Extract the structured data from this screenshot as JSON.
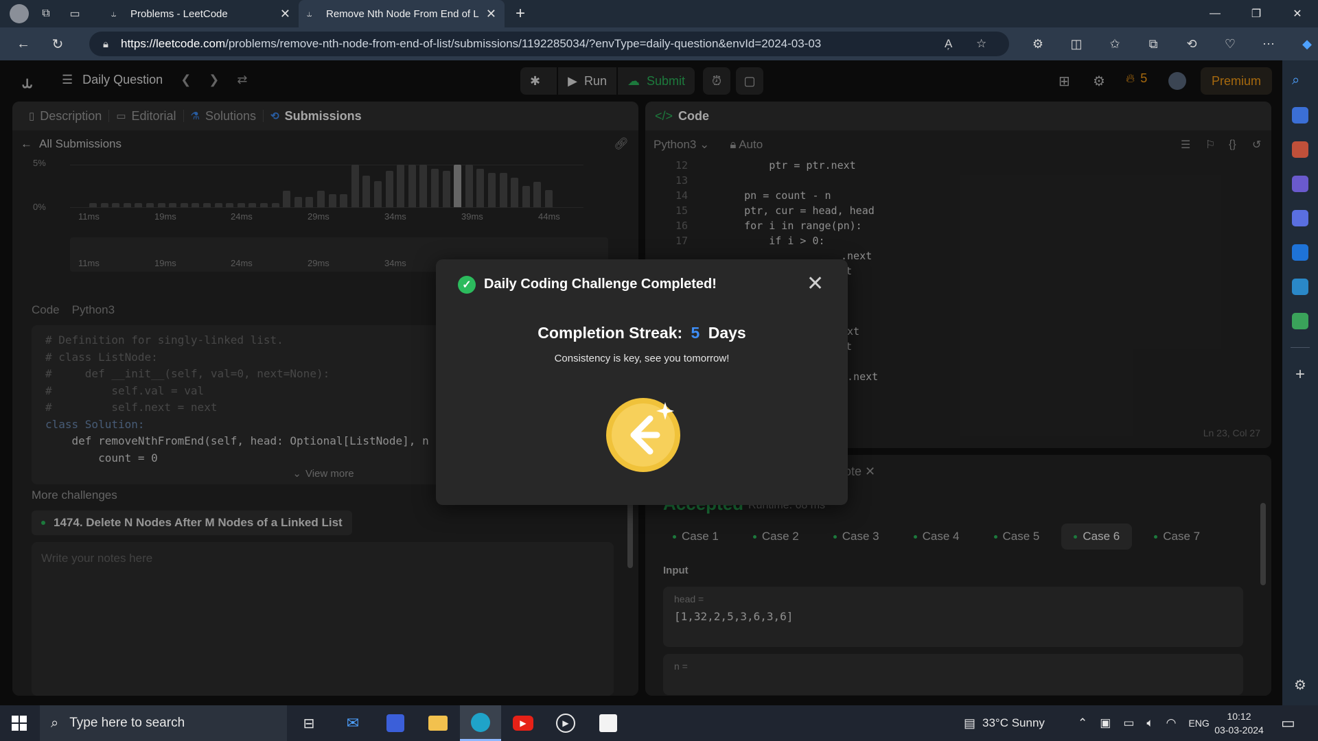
{
  "browser": {
    "tabs": [
      {
        "label": "Problems - LeetCode",
        "active": false
      },
      {
        "label": "Remove Nth Node From End of L",
        "active": true
      }
    ],
    "url_host": "https://leetcode.com",
    "url_path": "/problems/remove-nth-node-from-end-of-list/submissions/1192285034/?envType=daily-question&envId=2024-03-03"
  },
  "lc": {
    "daily_question": "Daily Question",
    "run": "Run",
    "submit": "Submit",
    "streak_count": "5",
    "premium": "Premium"
  },
  "left_panel": {
    "tabs": [
      "Description",
      "Editorial",
      "Solutions",
      "Submissions"
    ],
    "all_submissions": "All Submissions",
    "y_labels": [
      "5%",
      "0%"
    ],
    "x_labels": [
      "11ms",
      "19ms",
      "24ms",
      "29ms",
      "34ms",
      "39ms",
      "44ms"
    ],
    "mini_labels": [
      "11ms",
      "19ms",
      "24ms",
      "29ms",
      "34ms"
    ],
    "code_label": "Code",
    "code_lang": "Python3",
    "code_lines": [
      "# Definition for singly-linked list.",
      "# class ListNode:",
      "#     def __init__(self, val=0, next=None):",
      "#         self.val = val",
      "#         self.next = next",
      "class Solution:",
      "    def removeNthFromEnd(self, head: Optional[ListNode], n",
      "        count = 0"
    ],
    "view_more": "View more",
    "more_challenges": "More challenges",
    "challenge": "1474. Delete N Nodes After M Nodes of a Linked List",
    "notes_placeholder": "Write your notes here"
  },
  "code_panel": {
    "title": "Code",
    "lang": "Python3",
    "mode": "Auto",
    "line_numbers": [
      "12",
      "13",
      "14",
      "15",
      "16",
      "17"
    ],
    "lines": [
      "        ptr = ptr.next",
      "",
      "    pn = count - n",
      "    ptr, cur = head, head",
      "    for i in range(pn):",
      "        if i > 0:"
    ],
    "partial_lines": [
      ".next",
      "t",
      "ext",
      "t",
      "r.next"
    ],
    "cursor": "Ln 23, Col 27"
  },
  "result_panel": {
    "note_tab": "ote",
    "status": "Accepted",
    "runtime": "Runtime: 68 ms",
    "cases": [
      "Case 1",
      "Case 2",
      "Case 3",
      "Case 4",
      "Case 5",
      "Case 6",
      "Case 7"
    ],
    "active_case": 5,
    "input_label": "Input",
    "head_key": "head =",
    "head_value": "[1,32,2,5,3,6,3,6]",
    "n_key": "n ="
  },
  "modal": {
    "title": "Daily Coding Challenge Completed!",
    "streak_label": "Completion Streak:",
    "streak_value": "5",
    "streak_unit": "Days",
    "subtitle": "Consistency is key, see you tomorrow!"
  },
  "taskbar": {
    "search_placeholder": "Type here to search",
    "weather": "33°C  Sunny",
    "lang": "ENG",
    "time": "10:12",
    "date": "03-03-2024"
  },
  "colors": {
    "accent_green": "#2cbb5d",
    "accent_orange": "#ffa116",
    "streak_blue": "#3e8ef7",
    "coin": "#f7c948"
  },
  "histogram": {
    "bars": [
      0.1,
      0.1,
      0.1,
      0.1,
      0.1,
      0.1,
      0.1,
      0.1,
      0.1,
      0.1,
      0.1,
      0.1,
      0.1,
      0.1,
      0.1,
      0.1,
      0.1,
      0.38,
      0.25,
      0.25,
      0.38,
      0.3,
      0.3,
      1.0,
      0.75,
      0.62,
      0.85,
      1.0,
      1.0,
      1.0,
      0.9,
      0.85,
      1.0,
      1.0,
      0.9,
      0.8,
      0.8,
      0.7,
      0.5,
      0.6,
      0.4
    ],
    "selected_index": 32
  }
}
